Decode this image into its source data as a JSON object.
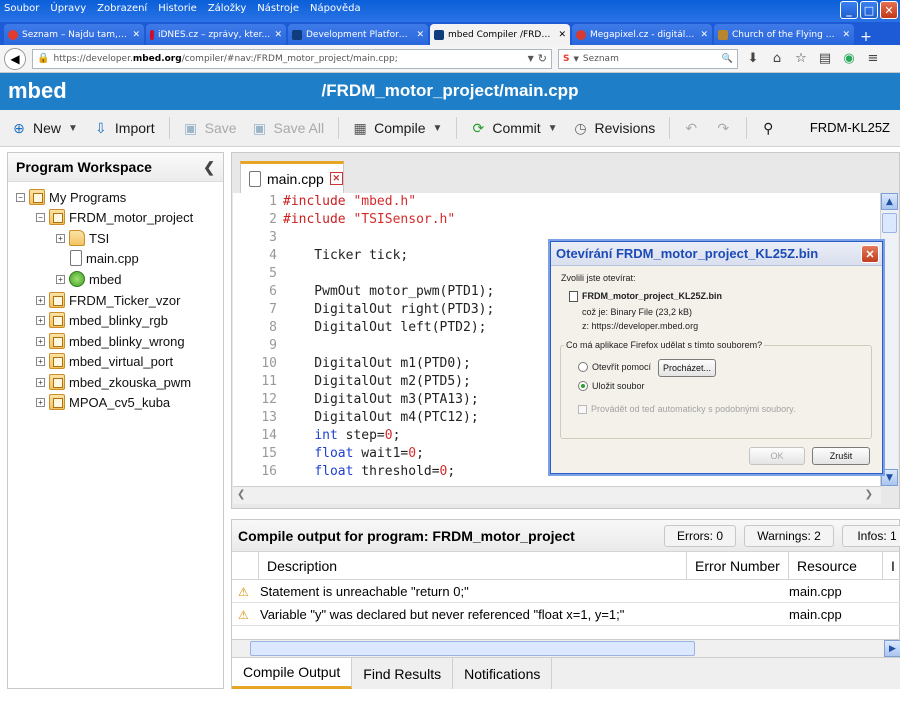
{
  "browser": {
    "menu": [
      "Soubor",
      "Úpravy",
      "Zobrazení",
      "Historie",
      "Záložky",
      "Nástroje",
      "Nápověda"
    ],
    "window_buttons": {
      "minimize": "_",
      "maximize": "□",
      "close": "✕"
    },
    "tabs": [
      {
        "title": "Seznam – Najdu tam, ...",
        "color": "#e23b2e"
      },
      {
        "title": "iDNES.cz – zprávy, kter...",
        "color": "#c8102e"
      },
      {
        "title": "Development Platform ...",
        "color": "#1e7fc8"
      },
      {
        "title": "mbed Compiler /FRDM...",
        "color": "#1e7fc8",
        "active": true
      },
      {
        "title": "Megapixel.cz - digitální...",
        "color": "#d83a2f"
      },
      {
        "title": "Church of the Flying Sp...",
        "color": "#b8862e"
      }
    ],
    "new_tab": "+",
    "url_prefix": "https://developer.",
    "url_domain": "mbed.org",
    "url_rest": "/compiler/#nav:/FRDM_motor_project/main.cpp;",
    "search_engine": "Seznam",
    "search_placeholder": "Seznam"
  },
  "header": {
    "logo": "mbed",
    "path": "/FRDM_motor_project/main.cpp"
  },
  "toolbar": {
    "new": "New",
    "import": "Import",
    "save": "Save",
    "save_all": "Save All",
    "compile": "Compile",
    "commit": "Commit",
    "revisions": "Revisions",
    "target": "FRDM-KL25Z"
  },
  "workspace": {
    "title": "Program Workspace",
    "items": [
      {
        "label": "My Programs"
      },
      {
        "label": "FRDM_motor_project"
      },
      {
        "label": "TSI"
      },
      {
        "label": "main.cpp"
      },
      {
        "label": "mbed"
      },
      {
        "label": "FRDM_Ticker_vzor"
      },
      {
        "label": "mbed_blinky_rgb"
      },
      {
        "label": "mbed_blinky_wrong"
      },
      {
        "label": "mbed_virtual_port"
      },
      {
        "label": "mbed_zkouska_pwm"
      },
      {
        "label": "MPOA_cv5_kuba"
      }
    ]
  },
  "editor": {
    "tab": "main.cpp",
    "lines": [
      {
        "n": "1",
        "t": "#include \"mbed.h\""
      },
      {
        "n": "2",
        "t": "#include \"TSISensor.h\""
      },
      {
        "n": "3",
        "t": ""
      },
      {
        "n": "4",
        "t": "    Ticker tick;"
      },
      {
        "n": "5",
        "t": ""
      },
      {
        "n": "6",
        "t": "    PwmOut motor_pwm(PTD1);"
      },
      {
        "n": "7",
        "t": "    DigitalOut right(PTD3);"
      },
      {
        "n": "8",
        "t": "    DigitalOut left(PTD2);"
      },
      {
        "n": "9",
        "t": ""
      },
      {
        "n": "10",
        "t": "    DigitalOut m1(PTD0);"
      },
      {
        "n": "11",
        "t": "    DigitalOut m2(PTD5);"
      },
      {
        "n": "12",
        "t": "    DigitalOut m3(PTA13);"
      },
      {
        "n": "13",
        "t": "    DigitalOut m4(PTC12);"
      },
      {
        "n": "14",
        "t": "    int step=0;"
      },
      {
        "n": "15",
        "t": "    float wait1=0;"
      },
      {
        "n": "16",
        "t": "    float threshold=0;"
      }
    ]
  },
  "dialog": {
    "title": "Otevírání FRDM_motor_project_KL25Z.bin",
    "intro": "Zvolili jste otevírat:",
    "filename": "FRDM_motor_project_KL25Z.bin",
    "type_line": "což je: Binary File (23,2 kB)",
    "from_line": "z:  https://developer.mbed.org",
    "question": "Co má aplikace Firefox udělat s tímto souborem?",
    "open_with": "Otevřít pomocí",
    "browse": "Procházet...",
    "save_file": "Uložit soubor",
    "auto_label": "Provádět od teď automaticky s podobnými soubory.",
    "ok": "OK",
    "cancel": "Zrušit"
  },
  "output": {
    "title": "Compile output for program: FRDM_motor_project",
    "errors": "Errors: 0",
    "warnings": "Warnings: 2",
    "infos": "Infos: 1",
    "columns": {
      "description": "Description",
      "error_number": "Error Number",
      "resource": "Resource",
      "extra": "I"
    },
    "rows": [
      {
        "description": "Statement is unreachable \"return 0;\"",
        "error_number": "",
        "resource": "main.cpp"
      },
      {
        "description": "Variable \"y\" was declared but never referenced \"float x=1, y=1;\"",
        "error_number": "",
        "resource": "main.cpp"
      }
    ],
    "tabs": [
      "Compile Output",
      "Find Results",
      "Notifications"
    ]
  }
}
